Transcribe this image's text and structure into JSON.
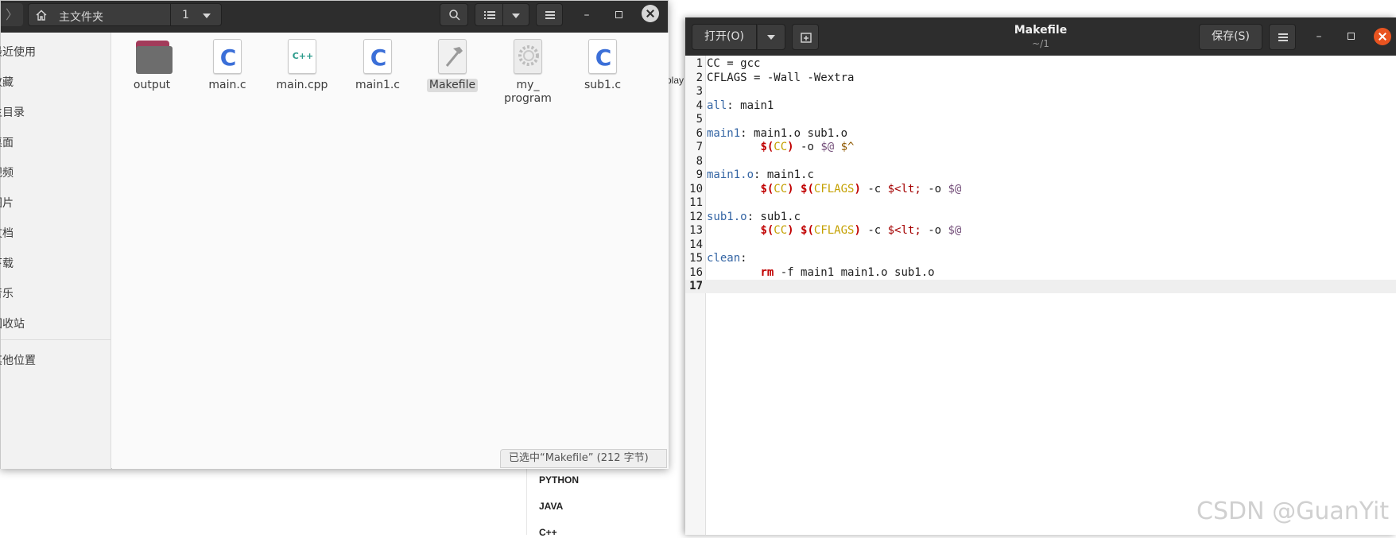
{
  "background": {
    "items": [
      "PYTHON",
      "JAVA",
      "C++"
    ],
    "partial_label": "play"
  },
  "file_manager": {
    "path": {
      "home_label": "主文件夹",
      "segment": "1"
    },
    "sidebar": {
      "items": [
        "最近使用",
        "收藏",
        "主目录",
        "桌面",
        "视频",
        "图片",
        "文档",
        "下载",
        "音乐",
        "回收站",
        "其他位置"
      ]
    },
    "files": [
      {
        "name": "output",
        "icon": "folder-icon"
      },
      {
        "name": "main.c",
        "icon": "c-source-icon",
        "glyph": "C"
      },
      {
        "name": "main.cpp",
        "icon": "cpp-source-icon",
        "glyph": "C++"
      },
      {
        "name": "main1.c",
        "icon": "c-source-icon",
        "glyph": "C"
      },
      {
        "name": "Makefile",
        "icon": "makefile-icon",
        "selected": true
      },
      {
        "name": "my_\nprogram",
        "icon": "executable-icon"
      },
      {
        "name": "sub1.c",
        "icon": "c-source-icon",
        "glyph": "C"
      }
    ],
    "status": "已选中“Makefile” (212 字节)"
  },
  "editor": {
    "open_label": "打开(O)",
    "title": "Makefile",
    "subtitle": "~/1",
    "save_label": "保存(S)",
    "current_line": 17,
    "lines": [
      "CC = gcc",
      "CFLAGS = -Wall -Wextra",
      "",
      "all: main1",
      "",
      "main1: main1.o sub1.o",
      "\t$(CC) -o $@ $^",
      "",
      "main1.o: main1.c",
      "\t$(CC) $(CFLAGS) -c $< -o $@",
      "",
      "sub1.o: sub1.c",
      "\t$(CC) $(CFLAGS) -c $< -o $@",
      "",
      "clean:",
      "\trm -f main1 main1.o sub1.o",
      ""
    ]
  },
  "watermark": "CSDN @GuanYit",
  "colors": {
    "header": "#2d2d2d",
    "editor_close": "#e95420",
    "makefile_target": "#3465a4",
    "makefile_variable": "#c00000"
  }
}
